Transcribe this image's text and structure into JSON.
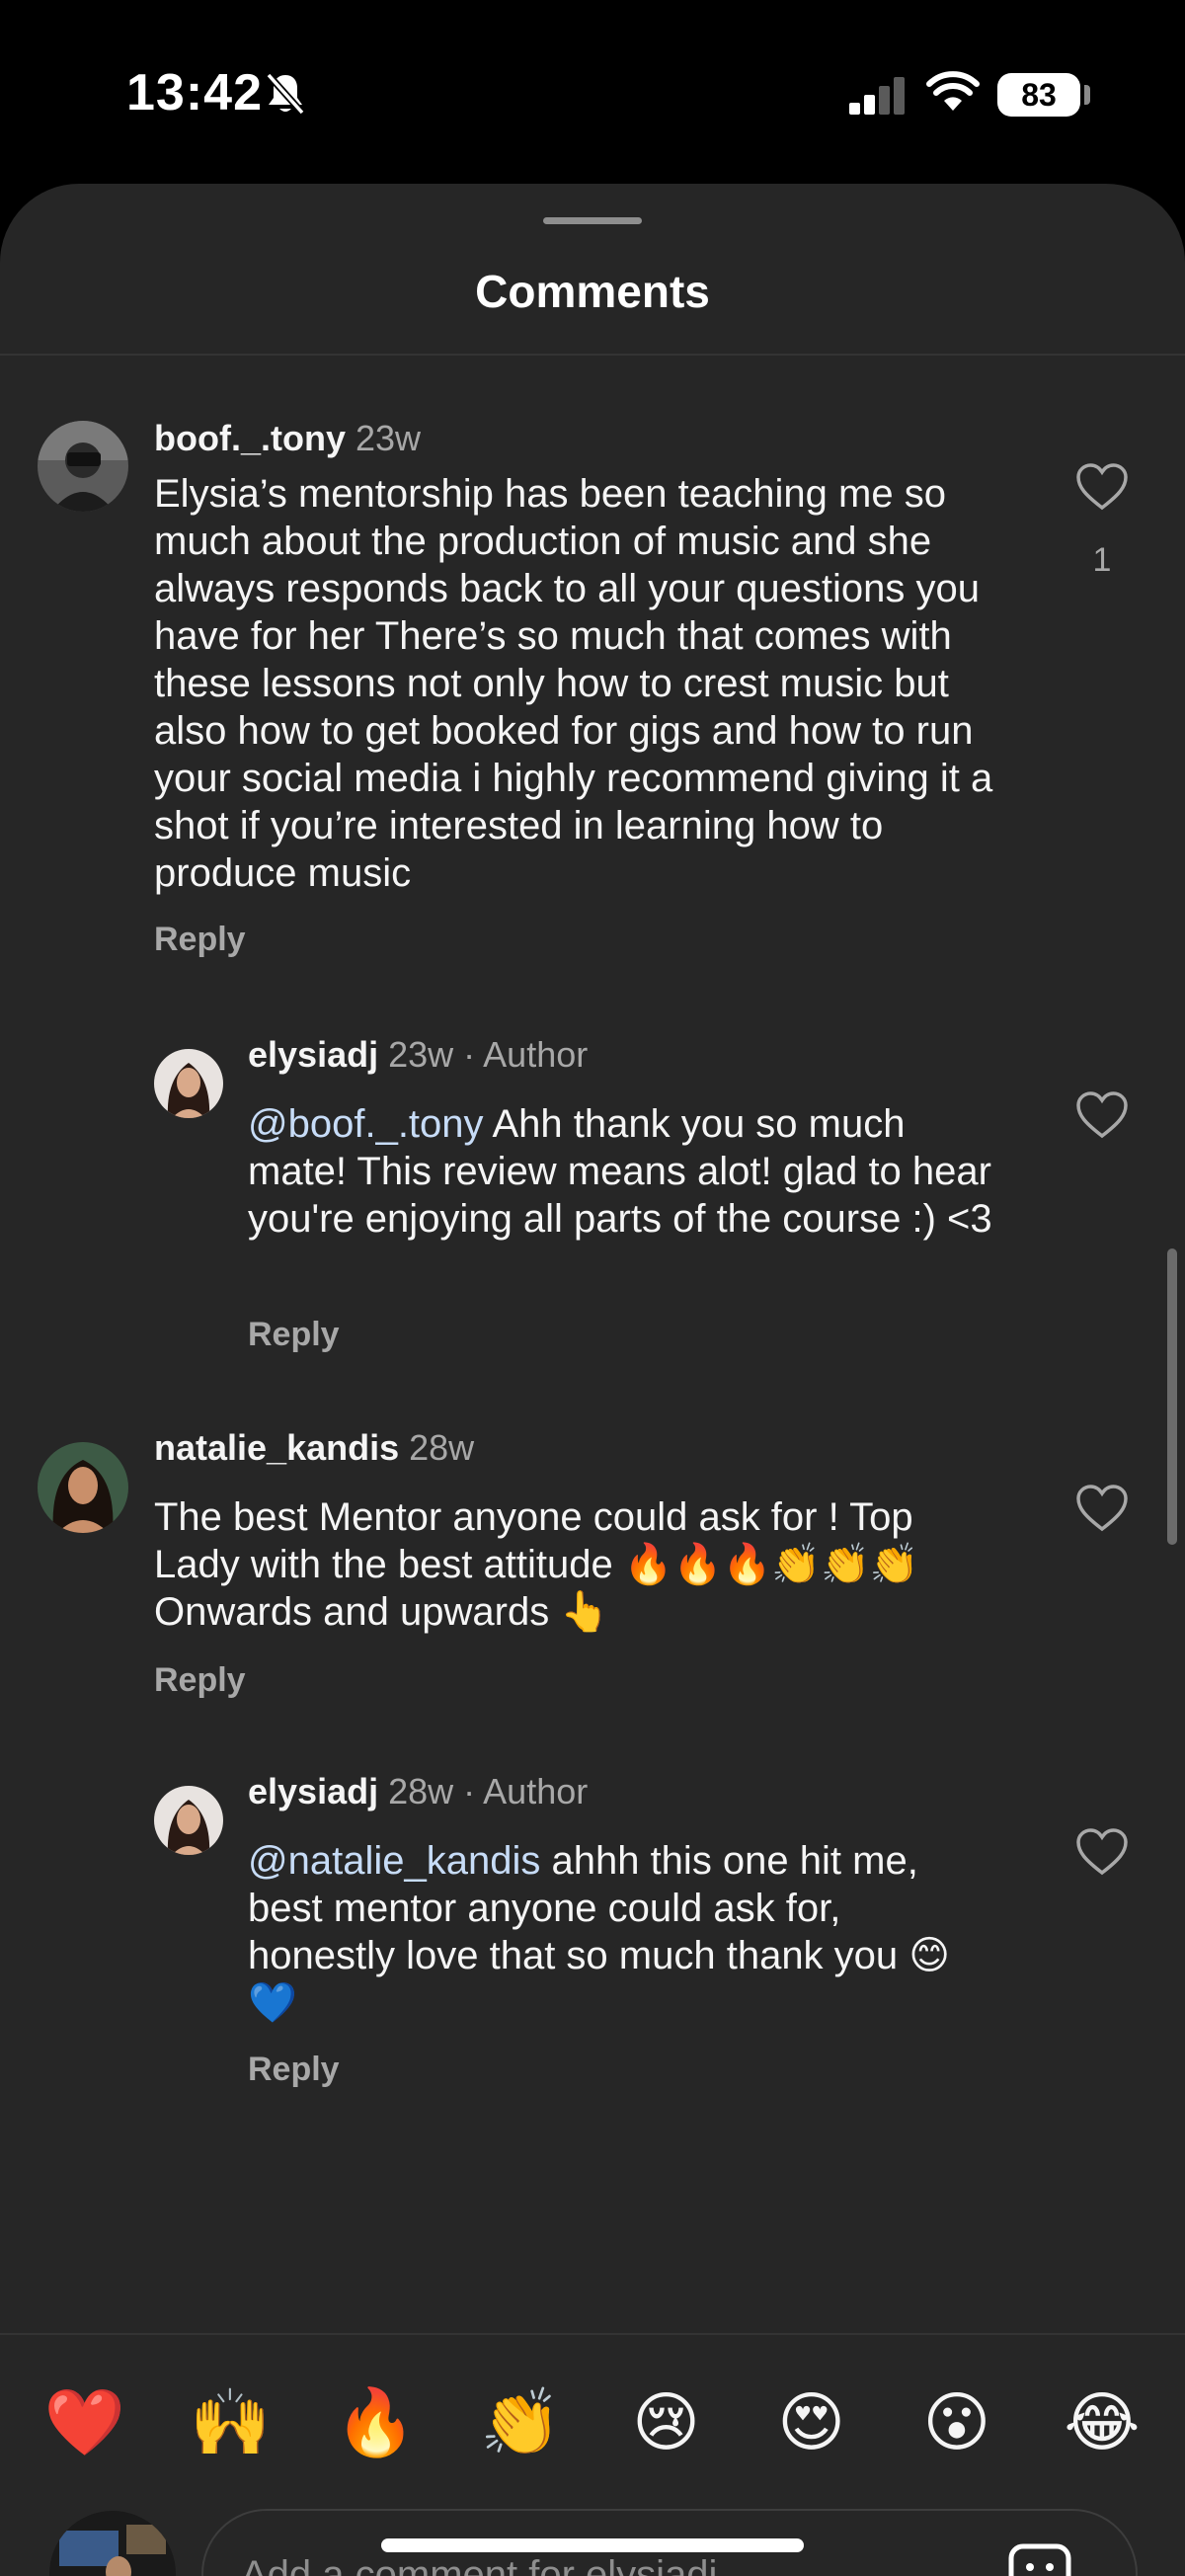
{
  "status": {
    "time": "13:42",
    "battery": "83"
  },
  "sheet": {
    "title": "Comments"
  },
  "comments": [
    {
      "username": "boof._.tony",
      "meta": "23w",
      "text": "Elysia’s mentorship has been teaching me so much about the production of music and she always responds back to all your questions you have for her  There’s so much that comes with these lessons not only how to crest music but also how to get booked for gigs and how to run your social media i highly recommend giving it a shot if you’re interested in learning how to produce music",
      "reply_label": "Reply",
      "likes": "1"
    },
    {
      "username": "elysiadj",
      "meta": "23w · Author",
      "mention": "@boof._.tony",
      "text": " Ahh thank you so much mate! This review means alot! glad to hear you're enjoying all parts of the course :) <3",
      "reply_label": "Reply"
    },
    {
      "username": "natalie_kandis",
      "meta": "28w",
      "text": "The best Mentor anyone could ask for ! Top Lady with the best attitude 🔥🔥🔥👏👏👏 Onwards and upwards 👆",
      "reply_label": "Reply"
    },
    {
      "username": "elysiadj",
      "meta": "28w · Author",
      "mention": "@natalie_kandis",
      "text": " ahhh this one hit me, best mentor anyone could ask for, honestly love that so much thank you 😊💙",
      "reply_label": "Reply"
    }
  ],
  "quick_reactions": [
    "❤️",
    "🙌",
    "🔥",
    "👏",
    "😢",
    "😍",
    "😮",
    "😂"
  ],
  "composer": {
    "placeholder": "Add a comment for elysiadj"
  },
  "colors": {
    "sheet_bg": "#262626",
    "text_primary": "#f5f5f5",
    "text_secondary": "#a8a8a8",
    "mention": "#c7dcf7"
  }
}
